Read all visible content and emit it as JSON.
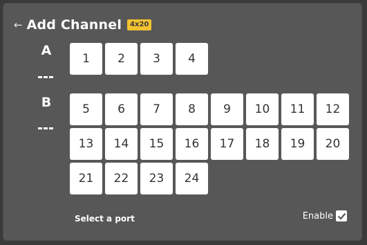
{
  "header": {
    "back_icon": "arrow-left-icon",
    "title": "Add Channel",
    "badge": "4x20"
  },
  "groups": [
    {
      "label": "A",
      "dash": "--",
      "ports": [
        "1",
        "2",
        "3",
        "4"
      ]
    },
    {
      "label": "B",
      "dash": "--",
      "ports": [
        "5",
        "6",
        "7",
        "8",
        "9",
        "10",
        "11",
        "12",
        "13",
        "14",
        "15",
        "16",
        "17",
        "18",
        "19",
        "20",
        "21",
        "22",
        "23",
        "24"
      ]
    }
  ],
  "footer": {
    "hint": "Select a port",
    "enable_label": "Enable",
    "enable_checked": true,
    "check_icon": "checkmark-icon"
  },
  "colors": {
    "panel": "#575757",
    "badge": "#f2c230",
    "port": "#ffffff"
  }
}
